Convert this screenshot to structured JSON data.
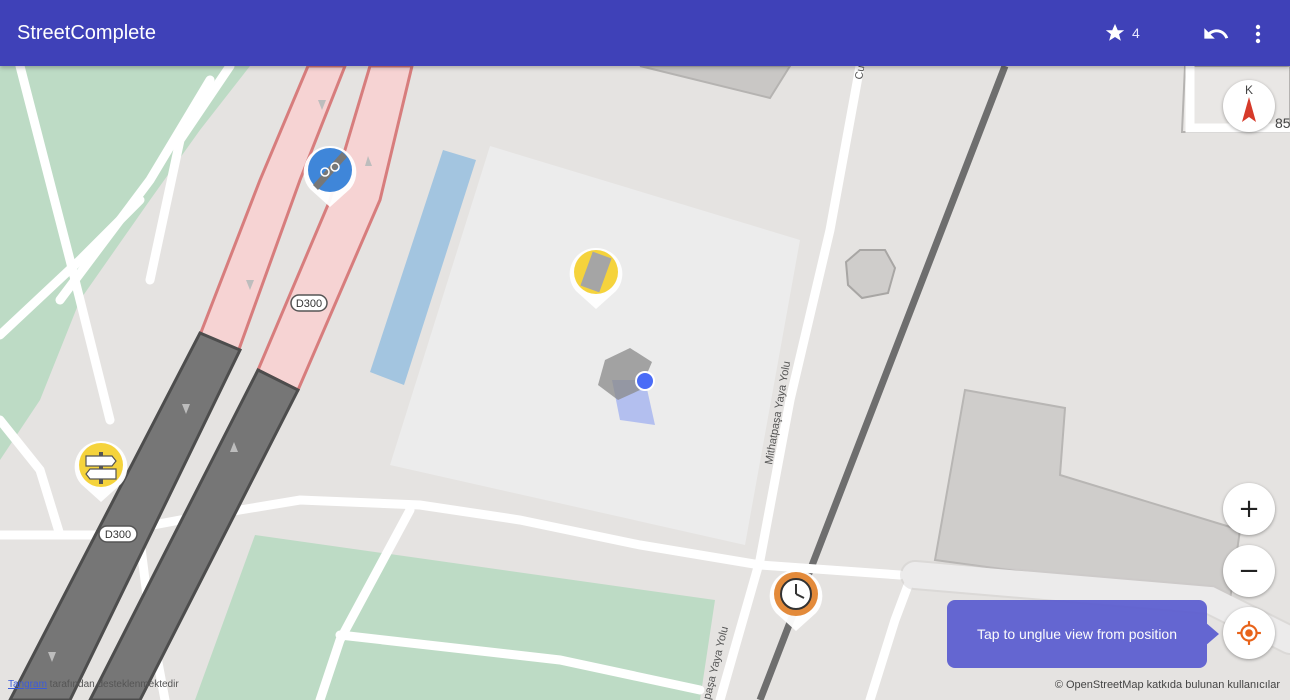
{
  "app": {
    "title": "StreetComplete"
  },
  "toolbar": {
    "star_count": "4"
  },
  "compass": {
    "label": "K"
  },
  "map_labels": {
    "road_d300_upper": "D300",
    "road_d300_lower": "D300",
    "street_mithatpasa": "Mithatpaşa Yaya Yolu",
    "street_yaya_yolu": "paşa Yaya Yolu",
    "street_bottom": "Yaya Yolu",
    "street_top": "Cu",
    "house_number": "85"
  },
  "tooltip": {
    "text": "Tap to unglue view from position"
  },
  "attribution": {
    "left_link": "Tangram",
    "left_text": " tarafından desteklenmektedir",
    "right_text": "© OpenStreetMap katkıda bulunan kullanıcılar"
  },
  "colors": {
    "appbar": "#3f41b8",
    "tooltip": "#5a5cd0",
    "quest_yellow": "#f5d33c",
    "quest_blue": "#3f86d9",
    "quest_orange": "#e38a3a",
    "location_dot": "#4a6cf7"
  },
  "icons": {
    "star": "star-icon",
    "undo": "undo-icon",
    "more": "more-vert-icon",
    "zoom_in": "plus-icon",
    "zoom_out": "minus-icon",
    "locate": "gps-fixed-icon"
  }
}
